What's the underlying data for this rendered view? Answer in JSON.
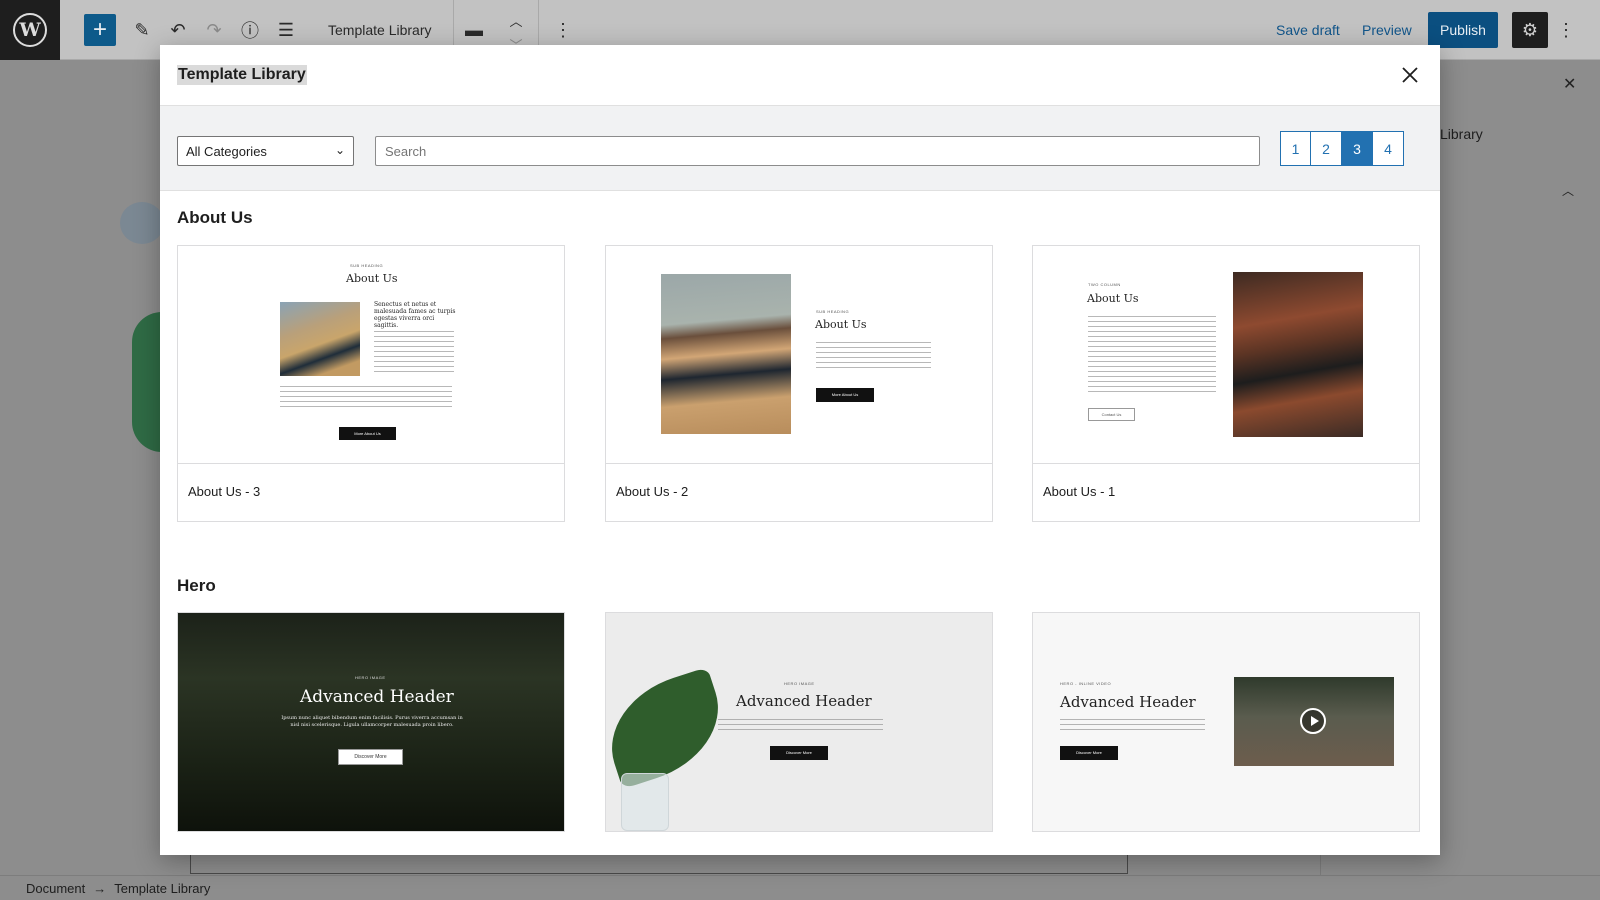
{
  "topbar": {
    "document_title": "Template Library",
    "save_draft": "Save draft",
    "preview": "Preview",
    "publish": "Publish"
  },
  "sidebar": {
    "library_label": "Library"
  },
  "footer": {
    "breadcrumb": [
      "Document",
      "Template Library"
    ]
  },
  "modal": {
    "title": "Template Library",
    "category_select": {
      "selected": "All Categories"
    },
    "search": {
      "placeholder": "Search",
      "value": ""
    },
    "pagination": {
      "pages": [
        "1",
        "2",
        "3",
        "4"
      ],
      "current": "3"
    },
    "sections": [
      {
        "title": "About Us",
        "templates": [
          {
            "label": "About Us - 3",
            "preview": {
              "eyebrow": "SUB HEADING",
              "heading": "About Us",
              "lead": "Senectus et netus et malesuada fames ac turpis egestas viverra orci sagittis.",
              "button": "More About Us"
            }
          },
          {
            "label": "About Us - 2",
            "preview": {
              "eyebrow": "SUB HEADING",
              "heading": "About Us",
              "button": "More About Us"
            }
          },
          {
            "label": "About Us - 1",
            "preview": {
              "eyebrow": "TWO COLUMN",
              "heading": "About Us",
              "button": "Contact Us"
            }
          }
        ]
      },
      {
        "title": "Hero",
        "templates": [
          {
            "preview": {
              "eyebrow": "HERO IMAGE",
              "heading": "Advanced Header",
              "text": "Ipsum nunc aliquet bibendum enim facilisis. Purus viverra accumsan in nisl nisi scelerisque. Ligula ullamcorper malesuada proin libero.",
              "button": "Discover More"
            }
          },
          {
            "preview": {
              "eyebrow": "HERO IMAGE",
              "heading": "Advanced Header",
              "button": "Discover More"
            }
          },
          {
            "preview": {
              "eyebrow": "HERO - INLINE VIDEO",
              "heading": "Advanced Header",
              "button": "Discover More"
            }
          }
        ]
      }
    ]
  }
}
